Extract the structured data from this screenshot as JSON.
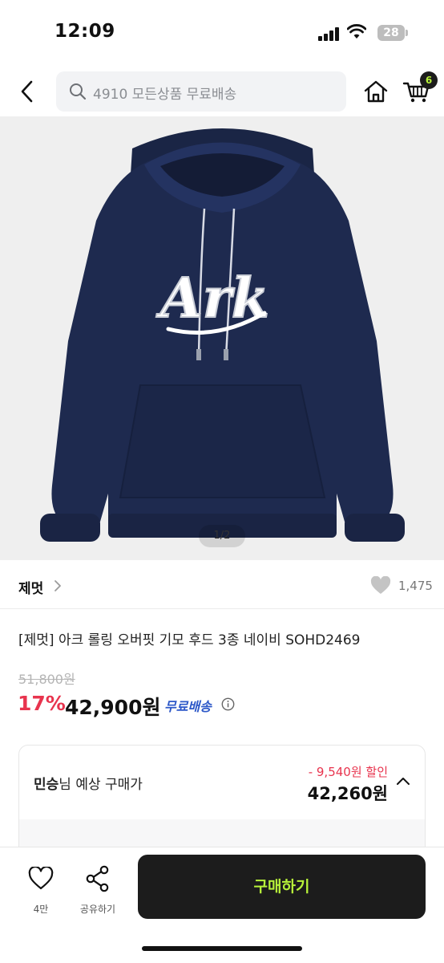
{
  "status_bar": {
    "time": "12:09",
    "battery": "28"
  },
  "header": {
    "search_text": "4910 모든상품 무료배송",
    "cart_count": "6"
  },
  "product_image": {
    "counter": "1/2",
    "logo_text": "Ark",
    "hoodie_color": "#1e2a4f"
  },
  "brand": {
    "name": "제멋",
    "like_count": "1,475"
  },
  "product": {
    "title": "[제멋] 아크 롤링 오버핏 기모 후드 3종 네이비 SOHD2469",
    "original_price": "51,800원",
    "discount_rate": "17%",
    "price": "42,900원",
    "shipping": "무료배송"
  },
  "expected_price": {
    "user": "민승",
    "label_suffix": "님 예상 구매가",
    "discount": "- 9,540원 할인",
    "price": "42,260원"
  },
  "bottom_bar": {
    "like_label": "4만",
    "share_label": "공유하기",
    "buy_label": "구매하기"
  },
  "colors": {
    "accent_red": "#e8344e",
    "buy_button_bg": "#1c1c1c",
    "buy_button_text": "#b7f23a",
    "shipping_blue": "#2d58c8"
  }
}
